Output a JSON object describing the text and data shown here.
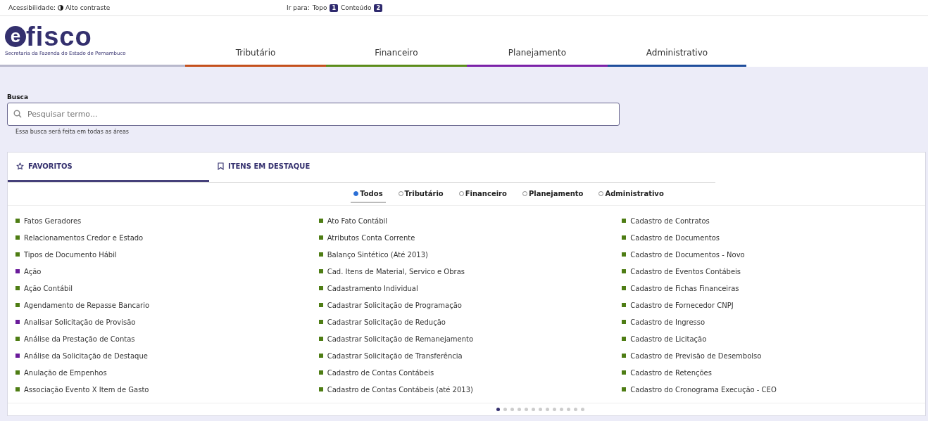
{
  "top_bar": {
    "accessibility_label": "Acessibilidade:",
    "contrast_link": "Alto contraste",
    "goto_label": "Ir para:",
    "shortcuts": [
      {
        "label": "Topo",
        "key": "1"
      },
      {
        "label": "Conteúdo",
        "key": "2"
      }
    ]
  },
  "logo": {
    "mark": "e",
    "name": "fisco",
    "subtitle": "Secretaria da Fazenda do Estado de Pernambuco"
  },
  "nav": [
    {
      "label": "Tributário",
      "color": "#c4501c"
    },
    {
      "label": "Financeiro",
      "color": "#5b8c1a"
    },
    {
      "label": "Planejamento",
      "color": "#7b21a8"
    },
    {
      "label": "Administrativo",
      "color": "#1f4e9c"
    }
  ],
  "search": {
    "label": "Busca",
    "placeholder": "Pesquisar termo...",
    "hint": "Essa busca será feita em todas as áreas"
  },
  "tabs": [
    {
      "label": "FAVORITOS",
      "kind": "star",
      "selected": true
    },
    {
      "label": "ITENS EM DESTAQUE",
      "kind": "bookmark",
      "selected": false
    }
  ],
  "filters": [
    {
      "label": "Todos",
      "selected": true
    },
    {
      "label": "Tributário",
      "selected": false
    },
    {
      "label": "Financeiro",
      "selected": false
    },
    {
      "label": "Planejamento",
      "selected": false
    },
    {
      "label": "Administrativo",
      "selected": false
    }
  ],
  "columns": [
    [
      {
        "label": "Fatos Geradores",
        "color": "#4e7d14"
      },
      {
        "label": "Relacionamentos Credor e Estado",
        "color": "#4e7d14"
      },
      {
        "label": "Tipos de Documento Hábil",
        "color": "#4e7d14"
      },
      {
        "label": "Ação",
        "color": "#6a1b9a"
      },
      {
        "label": "Ação Contábil",
        "color": "#4e7d14"
      },
      {
        "label": "Agendamento de Repasse Bancario",
        "color": "#4e7d14"
      },
      {
        "label": "Analisar Solicitação de Provisão",
        "color": "#6a1b9a"
      },
      {
        "label": "Análise da Prestação de Contas",
        "color": "#4e7d14"
      },
      {
        "label": "Análise da Solicitação de Destaque",
        "color": "#6a1b9a"
      },
      {
        "label": "Anulação de Empenhos",
        "color": "#4e7d14"
      },
      {
        "label": "Associação Evento X Item de Gasto",
        "color": "#4e7d14"
      }
    ],
    [
      {
        "label": "Ato Fato Contábil",
        "color": "#4e7d14"
      },
      {
        "label": "Atributos Conta Corrente",
        "color": "#4e7d14"
      },
      {
        "label": "Balanço Sintético (Até 2013)",
        "color": "#4e7d14"
      },
      {
        "label": "Cad. Itens de Material, Servico e Obras",
        "color": "#4e7d14"
      },
      {
        "label": "Cadastramento Individual",
        "color": "#4e7d14"
      },
      {
        "label": "Cadastrar Solicitação de Programação",
        "color": "#4e7d14"
      },
      {
        "label": "Cadastrar Solicitação de Redução",
        "color": "#4e7d14"
      },
      {
        "label": "Cadastrar Solicitação de Remanejamento",
        "color": "#4e7d14"
      },
      {
        "label": "Cadastrar Solicitação de Transferência",
        "color": "#4e7d14"
      },
      {
        "label": "Cadastro de Contas Contábeis",
        "color": "#4e7d14"
      },
      {
        "label": "Cadastro de Contas Contábeis (até 2013)",
        "color": "#4e7d14"
      }
    ],
    [
      {
        "label": "Cadastro de Contratos",
        "color": "#4e7d14"
      },
      {
        "label": "Cadastro de Documentos",
        "color": "#4e7d14"
      },
      {
        "label": "Cadastro de Documentos - Novo",
        "color": "#4e7d14"
      },
      {
        "label": "Cadastro de Eventos Contábeis",
        "color": "#4e7d14"
      },
      {
        "label": "Cadastro de Fichas Financeiras",
        "color": "#4e7d14"
      },
      {
        "label": "Cadastro de Fornecedor CNPJ",
        "color": "#4e7d14"
      },
      {
        "label": "Cadastro de Ingresso",
        "color": "#4e7d14"
      },
      {
        "label": "Cadastro de Licitação",
        "color": "#4e7d14"
      },
      {
        "label": "Cadastro de Previsão de Desembolso",
        "color": "#4e7d14"
      },
      {
        "label": "Cadastro de Retenções",
        "color": "#4e7d14"
      },
      {
        "label": "Cadastro do Cronograma Execução - CEO",
        "color": "#4e7d14"
      }
    ]
  ],
  "pages": [
    {
      "selected": true
    },
    {
      "selected": false
    },
    {
      "selected": false
    },
    {
      "selected": false
    },
    {
      "selected": false
    },
    {
      "selected": false
    },
    {
      "selected": false
    },
    {
      "selected": false
    },
    {
      "selected": false
    },
    {
      "selected": false
    },
    {
      "selected": false
    },
    {
      "selected": false
    },
    {
      "selected": false
    }
  ]
}
